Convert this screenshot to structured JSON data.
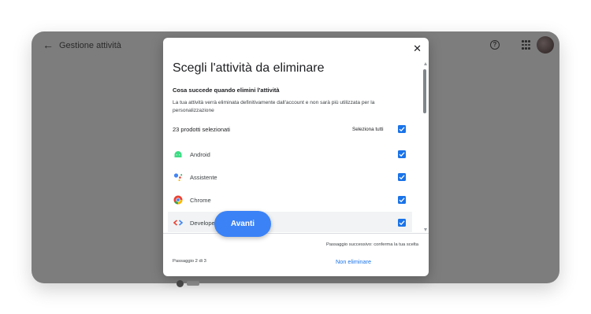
{
  "background": {
    "title": "Gestione attività",
    "back_icon": "arrow-left-icon",
    "help_icon": "help-circle-icon",
    "apps_icon": "apps-grid-icon",
    "avatar_icon": "user-avatar"
  },
  "dialog": {
    "close_symbol": "✕",
    "title": "Scegli l'attività da eliminare",
    "subheading": "Cosa succede quando elimini l'attività",
    "description": "La tua attività verrà eliminata definitivamente dall'account e non sarà più utilizzata per la personalizzazione",
    "count_label": "23 prodotti selezionati",
    "select_all_label": "Seleziona tutti",
    "select_all_checked": true,
    "products": [
      {
        "label": "Android",
        "icon": "android-icon",
        "checked": true
      },
      {
        "label": "Assistente",
        "icon": "assistant-icon",
        "checked": true
      },
      {
        "label": "Chrome",
        "icon": "chrome-icon",
        "checked": true
      },
      {
        "label": "Developers",
        "icon": "developers-icon",
        "checked": true
      }
    ],
    "next_step_text": "Passaggio successivo: conferma la tua scelta",
    "step_label": "Passaggio 2 di 3",
    "cancel_label": "Non eliminare",
    "next_label": "Avanti"
  },
  "colors": {
    "accent": "#1a73e8",
    "primary_button": "#3b82f6",
    "overlay": "#7d7d7d"
  }
}
